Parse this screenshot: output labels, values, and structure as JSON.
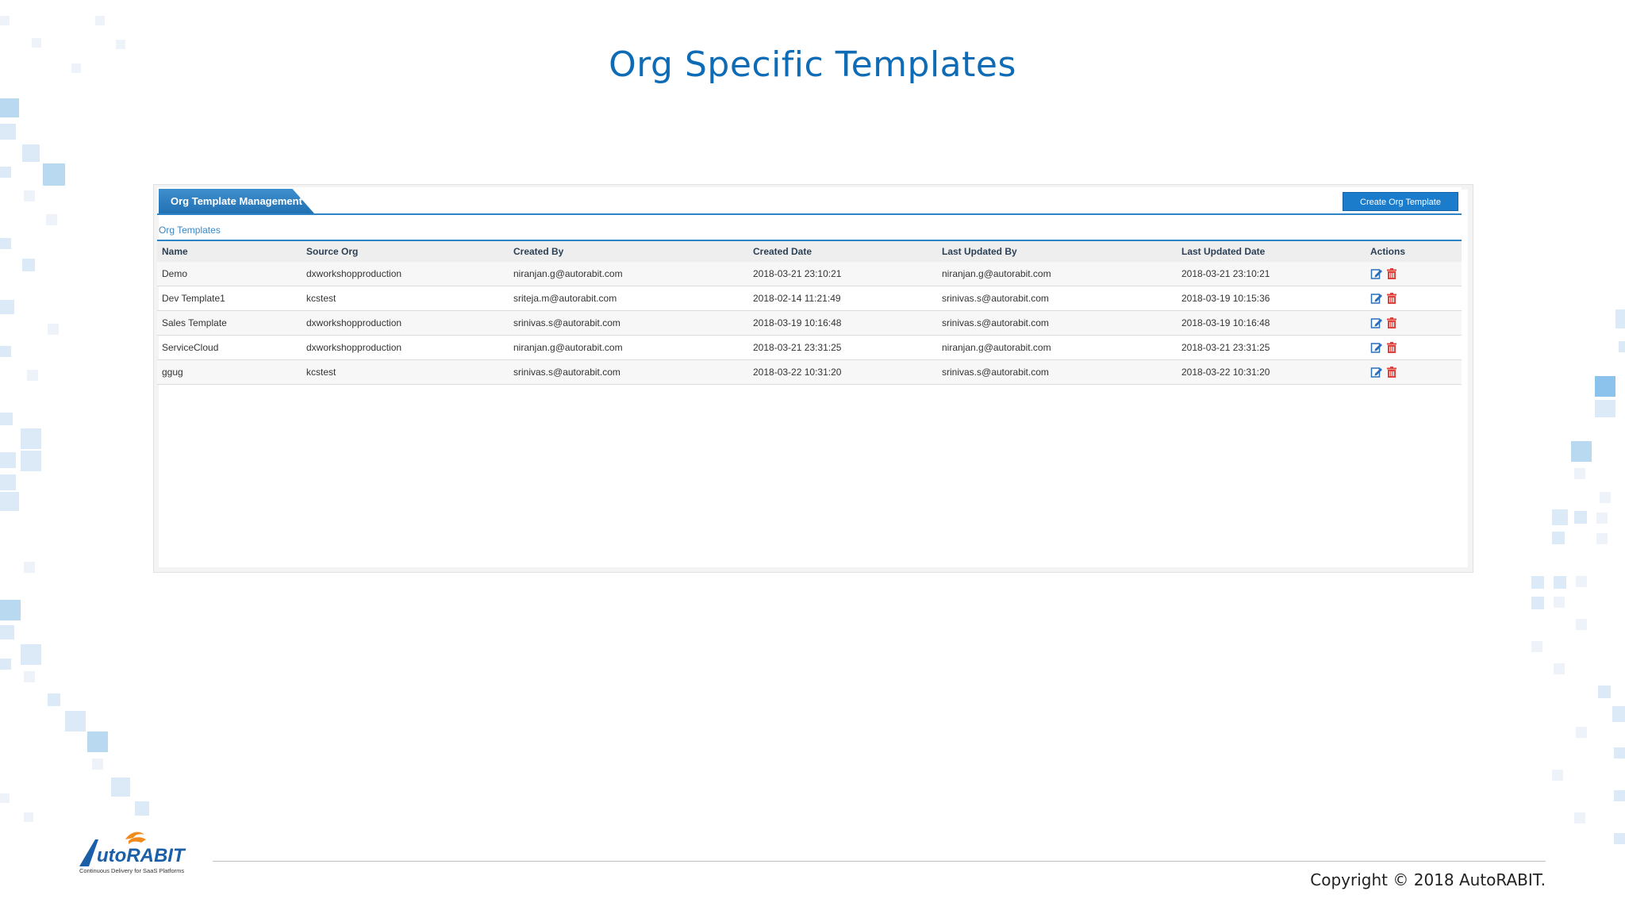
{
  "slide": {
    "title": "Org Specific Templates",
    "copyright": "Copyright © 2018 AutoRABIT."
  },
  "logo": {
    "text_part1": "utoRABIT",
    "tagline": "Continuous Delivery for SaaS Platforms"
  },
  "app": {
    "tab_label": "Org Template Management",
    "create_button_label": "Create Org Template",
    "section_label": "Org Templates",
    "columns": [
      "Name",
      "Source Org",
      "Created By",
      "Created Date",
      "Last Updated By",
      "Last Updated Date",
      "Actions"
    ],
    "rows": [
      {
        "name": "Demo",
        "source_org": "dxworkshopproduction",
        "created_by": "niranjan.g@autorabit.com",
        "created_date": "2018-03-21 23:10:21",
        "last_updated_by": "niranjan.g@autorabit.com",
        "last_updated_date": "2018-03-21 23:10:21"
      },
      {
        "name": "Dev Template1",
        "source_org": "kcstest",
        "created_by": "sriteja.m@autorabit.com",
        "created_date": "2018-02-14 11:21:49",
        "last_updated_by": "srinivas.s@autorabit.com",
        "last_updated_date": "2018-03-19 10:15:36"
      },
      {
        "name": "Sales Template",
        "source_org": "dxworkshopproduction",
        "created_by": "srinivas.s@autorabit.com",
        "created_date": "2018-03-19 10:16:48",
        "last_updated_by": "srinivas.s@autorabit.com",
        "last_updated_date": "2018-03-19 10:16:48"
      },
      {
        "name": "ServiceCloud",
        "source_org": "dxworkshopproduction",
        "created_by": "niranjan.g@autorabit.com",
        "created_date": "2018-03-21 23:31:25",
        "last_updated_by": "niranjan.g@autorabit.com",
        "last_updated_date": "2018-03-21 23:31:25"
      },
      {
        "name": "ggug",
        "source_org": "kcstest",
        "created_by": "srinivas.s@autorabit.com",
        "created_date": "2018-03-22 10:31:20",
        "last_updated_by": "srinivas.s@autorabit.com",
        "last_updated_date": "2018-03-22 10:31:20"
      }
    ],
    "action_icons": [
      "edit-icon",
      "delete-icon"
    ]
  },
  "colors": {
    "title": "#0e6cb6",
    "accent": "#2c83c5",
    "button": "#1b7ccc",
    "delete": "#e0413a"
  }
}
